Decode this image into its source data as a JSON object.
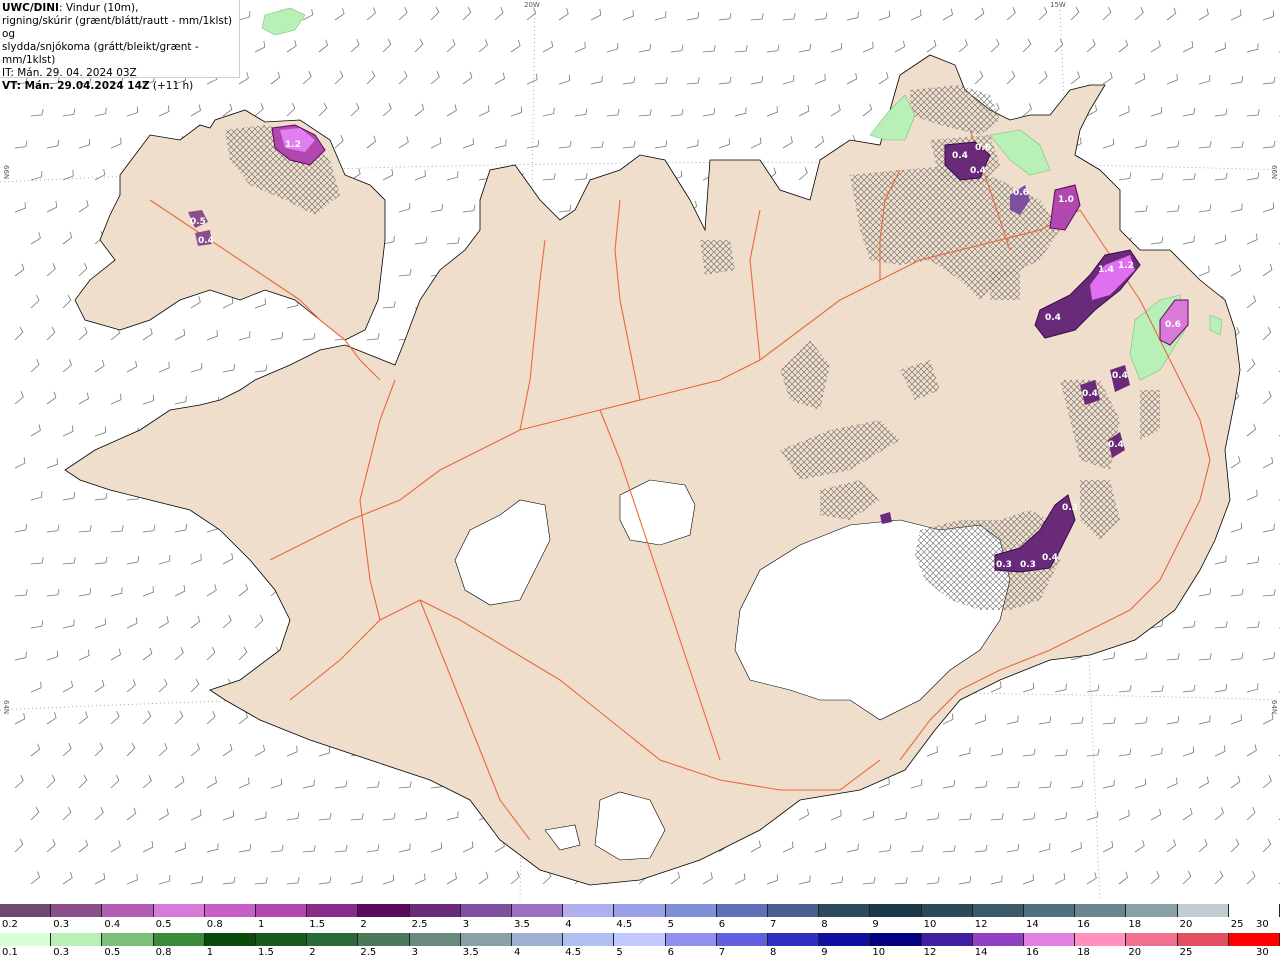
{
  "info": {
    "model": "UWC/DINI",
    "description_line1": ": Vindur (10m),",
    "description_line2": "rigning/skúrir (grænt/blátt/rautt - mm/1klst) og",
    "description_line3": "slydda/snjókoma (grátt/bleikt/grænt - mm/1klst)",
    "issue_time": "IT: Mán. 29. 04. 2024 03Z",
    "valid_prefix": "VT: Mán. 29.04.2024 14Z",
    "valid_offset": " (+11 h)"
  },
  "grid_labels": {
    "lon_20w": "20W",
    "lon_15w": "15W",
    "lat_left_top": "66N",
    "lat_right_top": "66N",
    "lat_left_bottom": "64N",
    "lat_right_bottom": "64N"
  },
  "legend_top": {
    "colors": [
      "#6e4a6e",
      "#8a4f8a",
      "#b35cb3",
      "#d97ad9",
      "#c85ec8",
      "#b048b0",
      "#8a2a8a",
      "#5a0a5a",
      "#6a2a7a",
      "#8050a0",
      "#9a70c0",
      "#b0b0f0",
      "#9aa0e8",
      "#8090d8",
      "#6070b8",
      "#4a6090",
      "#2a4a60",
      "#1a3a48",
      "#2a4a58",
      "#3a5a68",
      "#507080",
      "#6a8490",
      "#8aa0a8",
      "#c0ccd0",
      "#ffffff"
    ],
    "labels": [
      "0.2",
      "0.3",
      "0.4",
      "0.5",
      "0.8",
      "1",
      "1.5",
      "2",
      "2.5",
      "3",
      "3.5",
      "4",
      "4.5",
      "5",
      "6",
      "7",
      "8",
      "9",
      "10",
      "12",
      "14",
      "16",
      "18",
      "20",
      "25",
      "30"
    ]
  },
  "legend_bottom": {
    "colors": [
      "#d8ffd8",
      "#b8f0b8",
      "#7ac07a",
      "#3a8a3a",
      "#0a4a0a",
      "#1a5a1a",
      "#2a6a3a",
      "#4a7a5a",
      "#6a8a80",
      "#8aa0a8",
      "#a0b0d0",
      "#b0c0f0",
      "#c0c8ff",
      "#9090f0",
      "#6060e0",
      "#3030c0",
      "#1010a0",
      "#000080",
      "#4020a0",
      "#9040c0",
      "#e080e0",
      "#ff90c0",
      "#f07090",
      "#e05060",
      "#ff0000"
    ],
    "labels": [
      "0.1",
      "0.3",
      "0.5",
      "0.8",
      "1",
      "1.5",
      "2",
      "2.5",
      "3",
      "3.5",
      "4",
      "4.5",
      "5",
      "6",
      "7",
      "8",
      "9",
      "10",
      "12",
      "14",
      "16",
      "18",
      "20",
      "25",
      "30"
    ]
  },
  "map": {
    "land_color": "#efdecc",
    "road_color": "#e8693a",
    "glacier_color": "#ffffff",
    "sea_color": "#ffffff",
    "precip_labels": [
      "1.2",
      "0.5",
      "0.4",
      "0.4",
      "0.6",
      "0.4",
      "1.0",
      "0.6",
      "1.4",
      "1.2",
      "0.4",
      "0.6",
      "0.4",
      "0.4",
      "0.4",
      "0.3",
      "0.3",
      "0.3",
      "0.4"
    ]
  }
}
